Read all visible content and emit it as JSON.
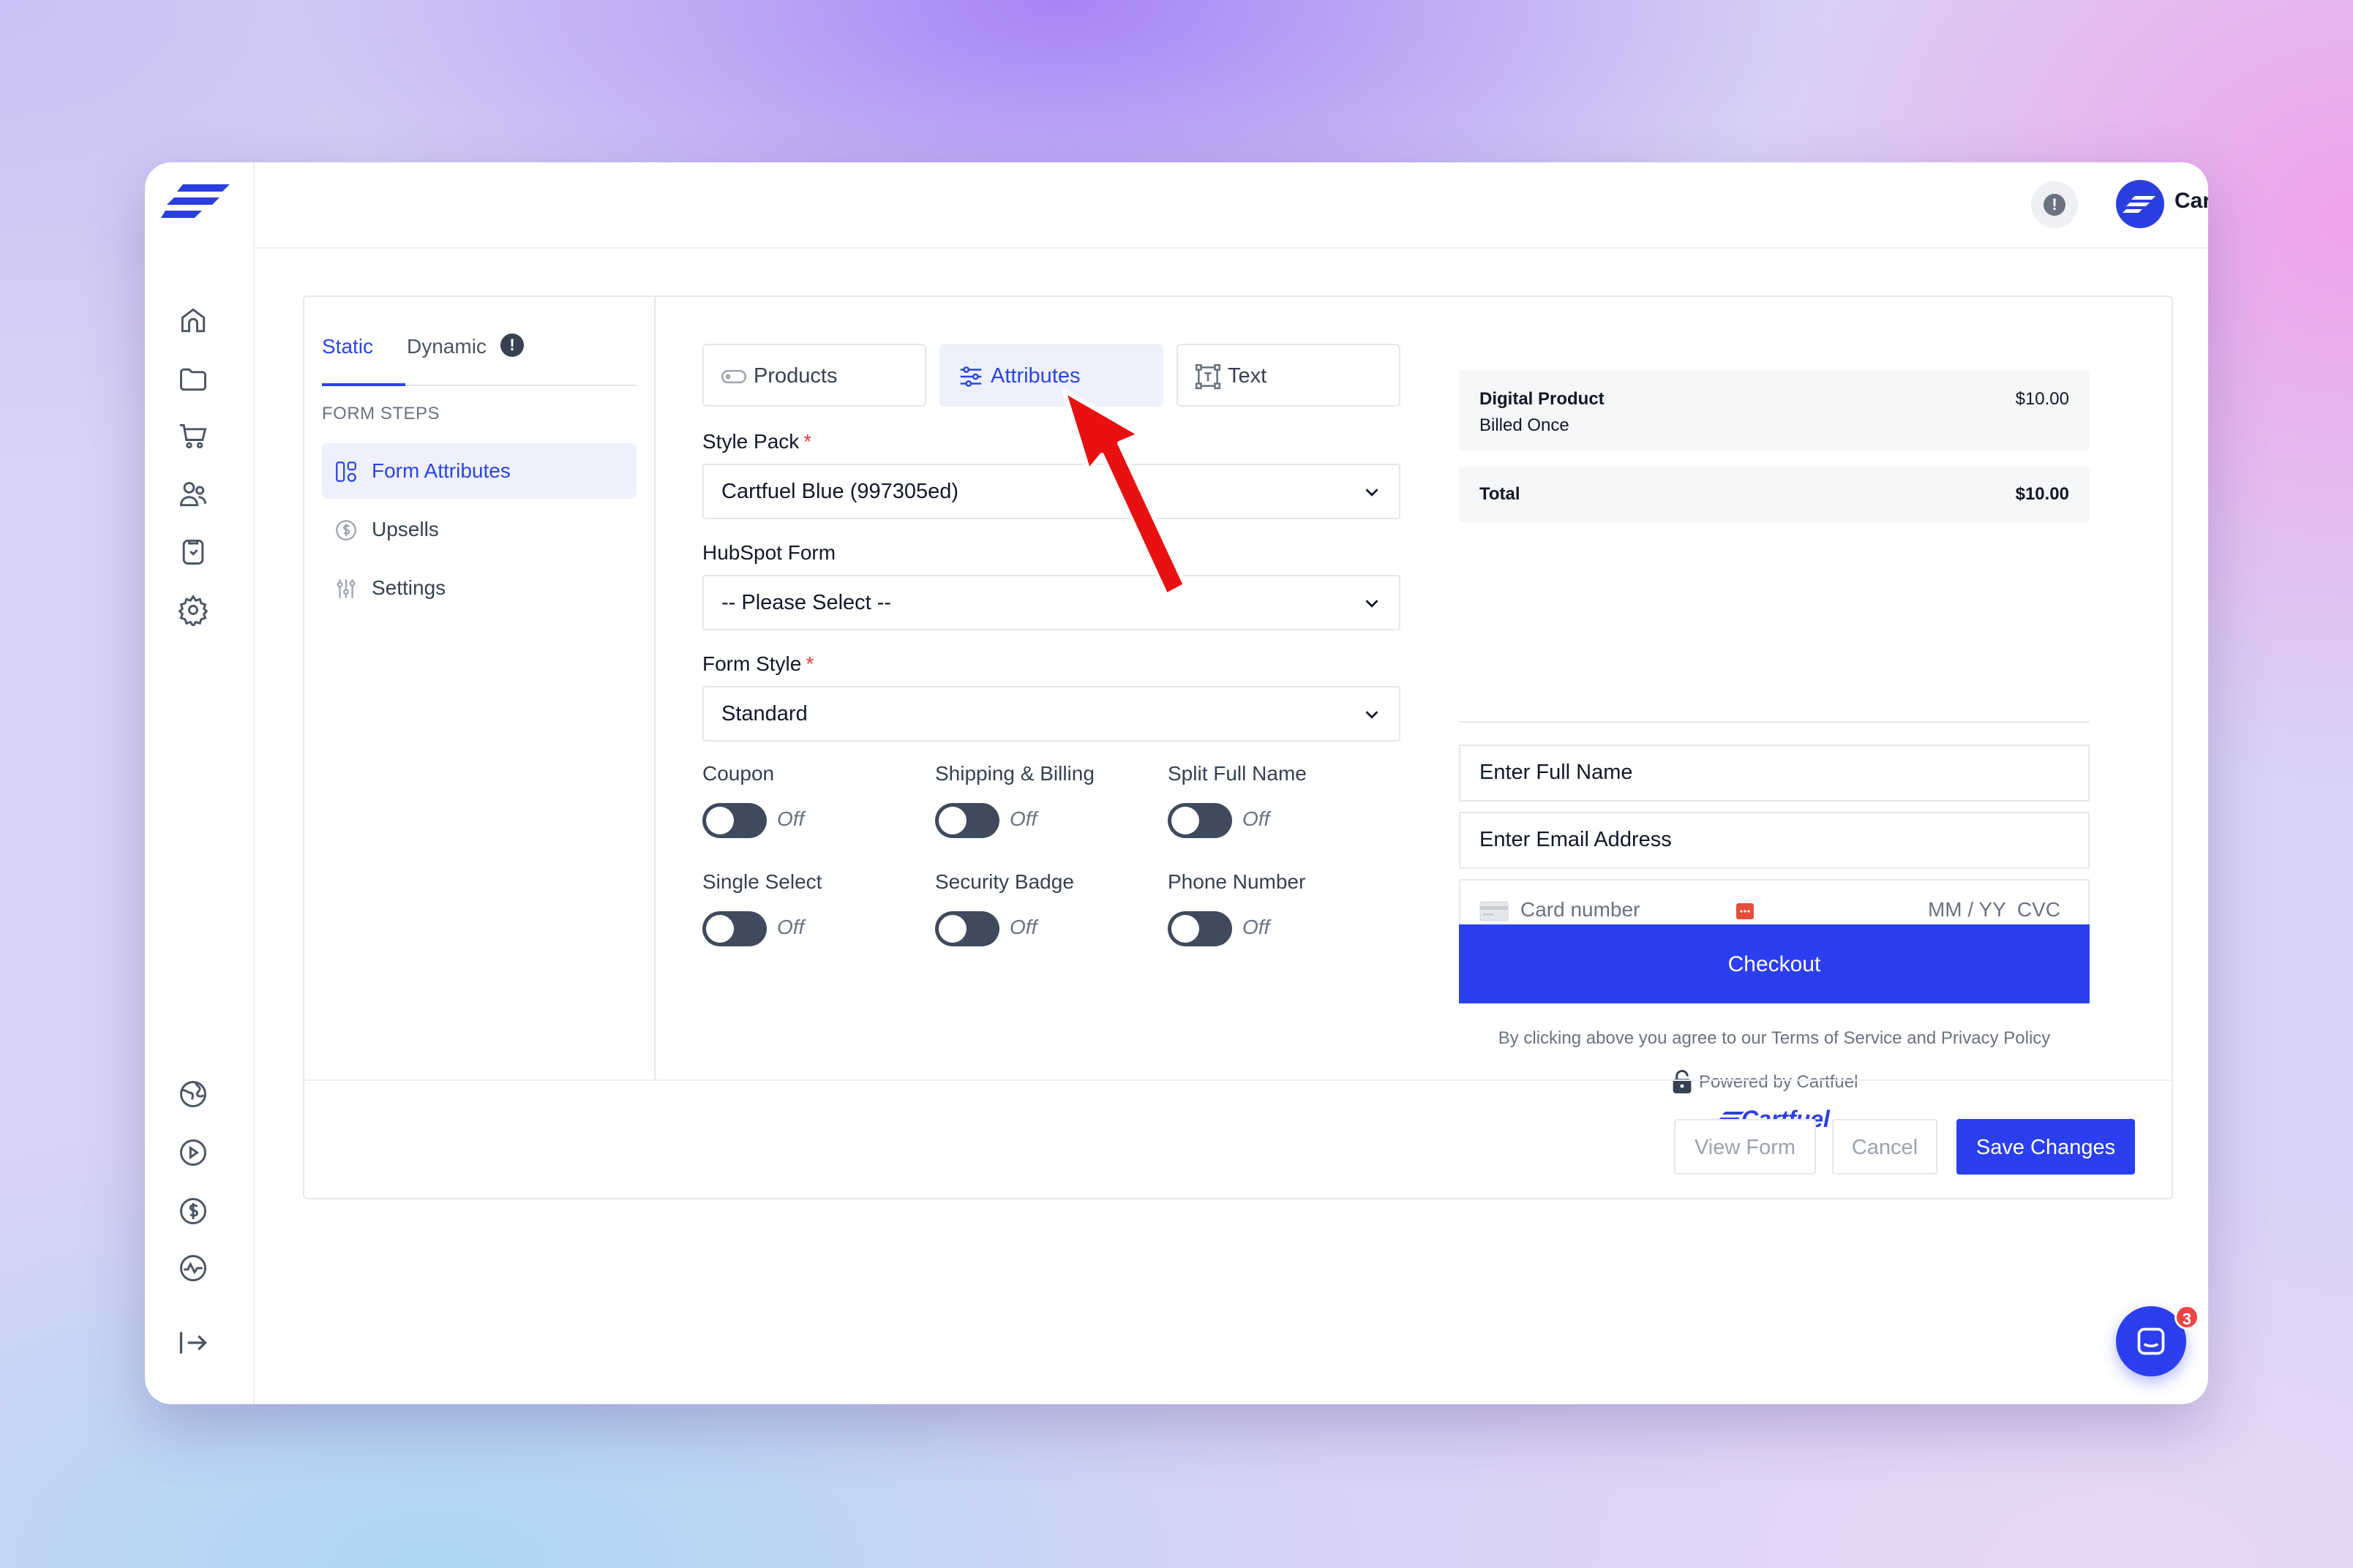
{
  "header": {
    "account_name": "Cartfuel",
    "alert_glyph": "!"
  },
  "sidebar_rail": {
    "top_icons": [
      "home-icon",
      "folder-icon",
      "cart-icon",
      "users-icon",
      "clipboard-icon",
      "settings-gear-icon"
    ],
    "bottom_icons": [
      "globe-icon",
      "play-circle-icon",
      "dollar-circle-icon",
      "activity-icon",
      "logout-icon"
    ]
  },
  "left_panel": {
    "tabs": [
      {
        "label": "Static",
        "active": true
      },
      {
        "label": "Dynamic",
        "badge": "!"
      }
    ],
    "steps_heading": "FORM STEPS",
    "steps": [
      {
        "label": "Form Attributes",
        "icon": "layout-icon",
        "active": true
      },
      {
        "label": "Upsells",
        "icon": "dollar-icon"
      },
      {
        "label": "Settings",
        "icon": "sliders-icon"
      }
    ]
  },
  "segments": [
    {
      "label": "Products",
      "icon": "tag-icon"
    },
    {
      "label": "Attributes",
      "icon": "sliders-icon",
      "active": true
    },
    {
      "label": "Text",
      "icon": "text-frame-icon"
    }
  ],
  "fields": {
    "style_pack": {
      "label": "Style Pack",
      "required": "*",
      "value": "Cartfuel Blue (997305ed)"
    },
    "hubspot_form": {
      "label": "HubSpot Form",
      "value": "-- Please Select --"
    },
    "form_style": {
      "label": "Form Style",
      "required": "*",
      "value": "Standard"
    }
  },
  "toggles": [
    {
      "label": "Coupon",
      "state": "Off"
    },
    {
      "label": "Shipping & Billing",
      "state": "Off"
    },
    {
      "label": "Split Full Name",
      "state": "Off"
    },
    {
      "label": "Single Select",
      "state": "Off"
    },
    {
      "label": "Security Badge",
      "state": "Off"
    },
    {
      "label": "Phone Number",
      "state": "Off"
    }
  ],
  "preview": {
    "product_name": "Digital Product",
    "billing": "Billed Once",
    "product_price": "$10.00",
    "total_label": "Total",
    "total_price": "$10.00",
    "full_name_placeholder": "Enter Full Name",
    "email_placeholder": "Enter Email Address",
    "card_placeholder": "Card number",
    "expiry_cvc": "MM / YY  CVC",
    "checkout_label": "Checkout",
    "agreement": "By clicking above you agree to our Terms of Service and Privacy Policy",
    "powered_by": "Powered by Cartfuel",
    "brand": "Cartfuel"
  },
  "actions": {
    "view_form": "View Form",
    "cancel": "Cancel",
    "save": "Save Changes"
  },
  "chat": {
    "unread_count": "3"
  },
  "colors": {
    "accent": "#2b3ff0",
    "toggle_off": "#3f4a5c",
    "required": "#e23b3b",
    "arrow": "#e81010"
  }
}
